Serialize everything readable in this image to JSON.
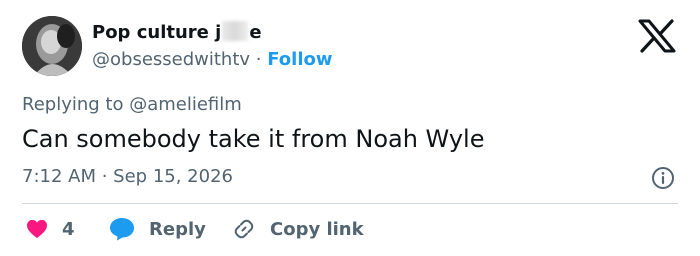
{
  "author": {
    "name_start": "Pop culture j",
    "name_end": "e",
    "handle": "@obsessedwithtv",
    "separator": " · ",
    "follow_label": "Follow"
  },
  "tweet": {
    "reply_prefix": "Replying to ",
    "reply_handle": "@ameliefilm",
    "text": "Can somebody take it from Noah Wyle",
    "time": "7:12 AM",
    "date_separator": " · ",
    "date": "Sep 15, 2026"
  },
  "actions": {
    "like_count": "4",
    "reply_label": "Reply",
    "copy_label": "Copy link"
  },
  "colors": {
    "accent": "#1d9bf0",
    "like": "#f91880",
    "muted": "#536471",
    "text": "#0f1419",
    "divider": "#cfd9de"
  },
  "icons": [
    "avatar-photo",
    "x-logo-icon",
    "info-icon",
    "heart-icon",
    "reply-bubble-icon",
    "link-icon"
  ]
}
